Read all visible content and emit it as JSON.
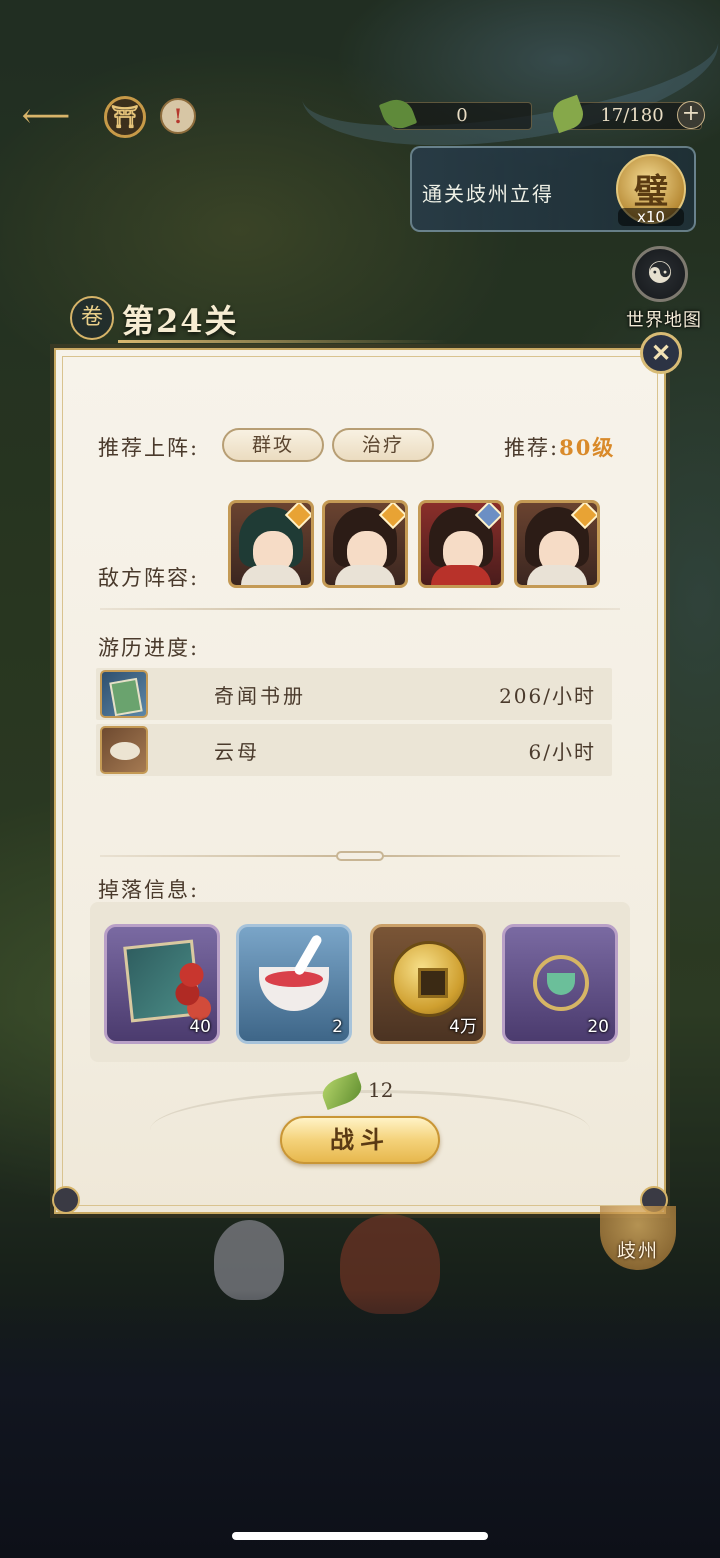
{
  "hud": {
    "grass_count": "0",
    "stamina": "17/180",
    "plus_symbol": "+",
    "alert_symbol": "!",
    "gate_symbol": "⛩"
  },
  "clear_reward": {
    "text": "通关歧州立得",
    "token_glyph": "璧",
    "token_qty": "x10"
  },
  "world_map": {
    "label": "世界地图",
    "icon_glyph": "☯"
  },
  "stage": {
    "title": "第24关",
    "emblem": "卷"
  },
  "panel": {
    "recommend_label": "推荐上阵:",
    "tags": [
      "群攻",
      "治疗"
    ],
    "recommend_level_prefix": "推荐:",
    "recommend_level_value": "80级",
    "enemy_label": "敌方阵容:",
    "enemies": [
      {
        "badge": "sun"
      },
      {
        "badge": "sun"
      },
      {
        "badge": "star"
      },
      {
        "badge": "sun"
      }
    ],
    "progress_label": "游历进度:",
    "progress": [
      {
        "name": "奇闻书册",
        "rate": "206/小时",
        "icon": "book-icon"
      },
      {
        "name": "云母",
        "rate": "6/小时",
        "icon": "mica-icon"
      }
    ],
    "drops_label": "掉落信息:",
    "drops": [
      {
        "qty": "40",
        "icon": "book-item-icon"
      },
      {
        "qty": "2",
        "icon": "bowl-item-icon"
      },
      {
        "qty": "4万",
        "icon": "coin-item-icon"
      },
      {
        "qty": "20",
        "icon": "incense-burner-icon"
      }
    ],
    "cost": "12",
    "fight_label": "战斗",
    "close_symbol": "✕"
  },
  "city": {
    "name": "歧州"
  },
  "colors": {
    "accent_gold": "#d8bb75",
    "level_orange": "#d98a2a",
    "panel_bg": "#f7f3ea",
    "text_brown": "#4a3a2c"
  }
}
